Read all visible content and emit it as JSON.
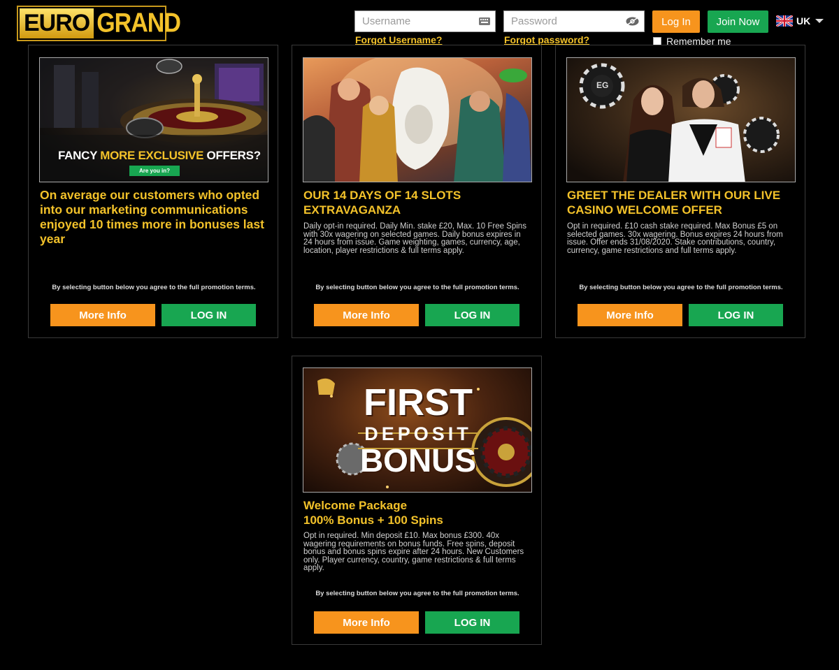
{
  "header": {
    "logo": {
      "part1": "EURO",
      "part2": "GRAND"
    },
    "username_placeholder": "Username",
    "password_placeholder": "Password",
    "forgot_username": "Forgot Username?",
    "forgot_password": "Forgot password?",
    "login_label": "Log In",
    "join_label": "Join Now",
    "remember_label": "Remember me",
    "language": "UK"
  },
  "colors": {
    "accent_gold": "#f3c22a",
    "orange": "#f7941d",
    "green": "#18a651"
  },
  "cards": [
    {
      "banner": {
        "line1_a": "FANCY ",
        "line1_b": "MORE EXCLUSIVE",
        "line1_c": " OFFERS?",
        "ribbon": "Are you in?"
      },
      "title": "On average our customers who opted into our marketing communications enjoyed 10 times more in bonuses last year",
      "desc": "",
      "terms": "By selecting button below you agree to the full promotion terms.",
      "more_label": "More Info",
      "login_label": "LOG IN"
    },
    {
      "banner": {},
      "title": "OUR 14 DAYS OF 14 SLOTS EXTRAVAGANZA",
      "desc": "Daily opt-in required. Daily Min. stake £20, Max. 10 Free Spins with 30x wagering on selected games. Daily bonus expires in 24 hours from issue. Game weighting, games, currency, age, location, player restrictions & full terms apply.",
      "terms": "By selecting button below you agree to the full promotion terms.",
      "more_label": "More Info",
      "login_label": "LOG IN"
    },
    {
      "banner": {
        "chip": "EG"
      },
      "title": "GREET THE DEALER WITH OUR LIVE CASINO WELCOME OFFER",
      "desc": "Opt in required. £10 cash stake required. Max Bonus £5 on selected games. 30x wagering. Bonus expires 24 hours from issue. Offer ends 31/08/2020. Stake contributions, country, currency, game restrictions and full terms apply.",
      "terms": "By selecting button below you agree to the full promotion terms.",
      "more_label": "More Info",
      "login_label": "LOG IN"
    },
    {
      "banner": {
        "line1": "FIRST",
        "line2": "DEPOSIT",
        "line3": "BONUS"
      },
      "title_line1": "Welcome Package",
      "title_line2": "100% Bonus + 100 Spins",
      "desc": "Opt in required. Min deposit £10. Max bonus £300. 40x wagering requirements on bonus funds. Free spins, deposit bonus and bonus spins expire after 24 hours. New Customers only. Player currency, country, game restrictions & full terms apply.",
      "terms": "By selecting button below you agree to the full promotion terms.",
      "more_label": "More Info",
      "login_label": "LOG IN"
    }
  ]
}
